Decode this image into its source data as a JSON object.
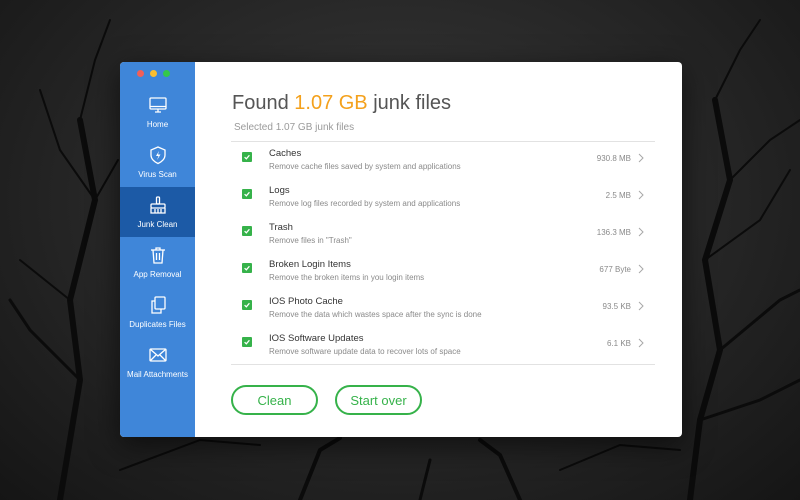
{
  "window": {
    "traffic_lights": [
      "close",
      "minimize",
      "zoom"
    ]
  },
  "sidebar": {
    "items": [
      {
        "label": "Home",
        "icon": "monitor-icon",
        "active": false
      },
      {
        "label": "Virus Scan",
        "icon": "shield-icon",
        "active": false
      },
      {
        "label": "Junk Clean",
        "icon": "broom-icon",
        "active": true
      },
      {
        "label": "App Removal",
        "icon": "trash-icon",
        "active": false
      },
      {
        "label": "Duplicates Files",
        "icon": "duplicate-icon",
        "active": false
      },
      {
        "label": "Mail Attachments",
        "icon": "mail-icon",
        "active": false
      }
    ]
  },
  "header": {
    "title_prefix": "Found ",
    "title_amount": "1.07 GB",
    "title_suffix": " junk files",
    "subtitle": "Selected 1.07 GB junk files"
  },
  "items": [
    {
      "name": "Caches",
      "desc": "Remove cache files saved by system and applications",
      "size": "930.8 MB",
      "checked": true
    },
    {
      "name": "Logs",
      "desc": "Remove log files recorded by system and applications",
      "size": "2.5 MB",
      "checked": true
    },
    {
      "name": "Trash",
      "desc": "Remove files in \"Trash\"",
      "size": "136.3 MB",
      "checked": true
    },
    {
      "name": "Broken Login Items",
      "desc": "Remove the broken items in you login items",
      "size": "677 Byte",
      "checked": true
    },
    {
      "name": "IOS Photo Cache",
      "desc": "Remove the data which wastes space after the sync is done",
      "size": "93.5 KB",
      "checked": true
    },
    {
      "name": "IOS Software Updates",
      "desc": "Remove software update data to recover lots of space",
      "size": "6.1 KB",
      "checked": true
    }
  ],
  "buttons": {
    "clean": "Clean",
    "start_over": "Start over"
  },
  "colors": {
    "sidebar": "#3f86d9",
    "sidebar_active": "#1c5aa6",
    "accent": "#f4a11c",
    "green": "#36b24a"
  }
}
